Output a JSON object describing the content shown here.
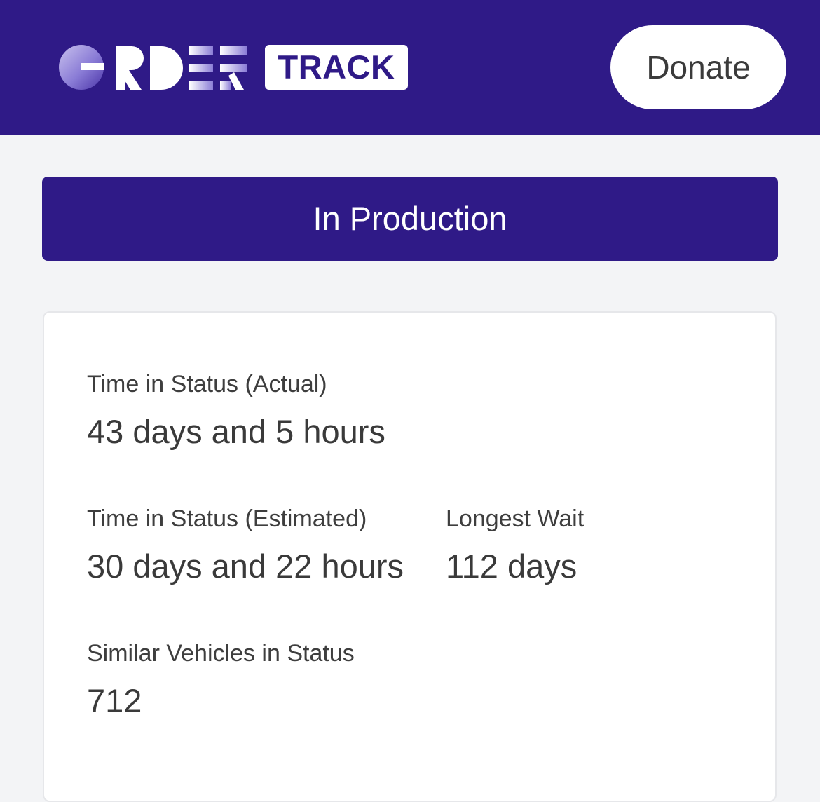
{
  "header": {
    "logo_word": "ORDER",
    "logo_badge": "TRACK",
    "donate_label": "Donate"
  },
  "status": {
    "label": "In Production"
  },
  "stats": {
    "actual": {
      "label": "Time in Status (Actual)",
      "value": "43 days and 5 hours"
    },
    "estimated": {
      "label": "Time in Status (Estimated)",
      "value": "30 days and 22 hours"
    },
    "longest": {
      "label": "Longest Wait",
      "value": "112 days"
    },
    "similar": {
      "label": "Similar Vehicles in Status",
      "value": "712"
    }
  },
  "colors": {
    "brand": "#2f1a87",
    "background": "#f3f4f6",
    "card": "#ffffff"
  }
}
